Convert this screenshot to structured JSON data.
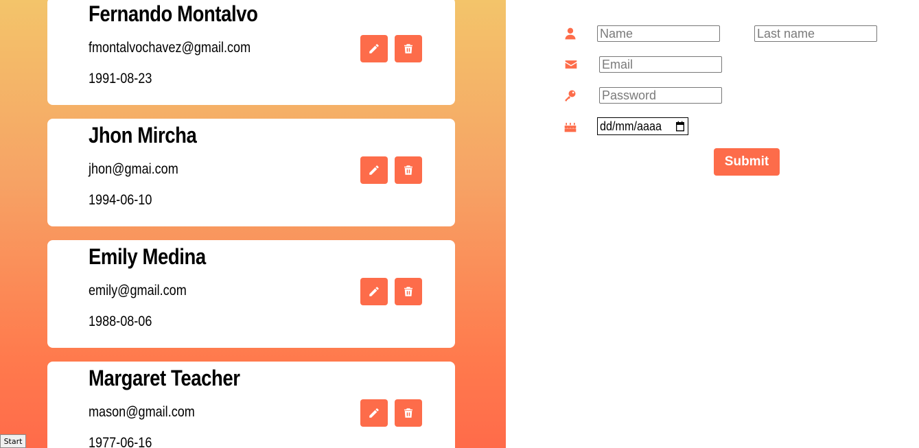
{
  "contacts": [
    {
      "name": "Fernando Montalvo",
      "email": "fmontalvochavez@gmail.com",
      "birthdate": "1991-08-23"
    },
    {
      "name": "Jhon Mircha",
      "email": "jhon@gmai.com",
      "birthdate": "1994-06-10"
    },
    {
      "name": "Emily Medina",
      "email": "emily@gmail.com",
      "birthdate": "1988-08-06"
    },
    {
      "name": "Margaret Teacher",
      "email": "mason@gmail.com",
      "birthdate": "1977-06-16"
    }
  ],
  "icons": {
    "edit": "pencil-icon",
    "delete": "trash-icon",
    "name": "user-icon",
    "email": "envelope-icon",
    "password": "key-icon",
    "birthdate": "cake-icon"
  },
  "form": {
    "name_placeholder": "Name",
    "lastname_placeholder": "Last name",
    "email_placeholder": "Email",
    "password_placeholder": "Password",
    "date_value": "dd/mm/aaaa",
    "submit_label": "Submit"
  },
  "taskbar": {
    "start_label": "Start"
  },
  "colors": {
    "accent": "#fd6c4a",
    "gradient_top": "#f3c46a",
    "gradient_bottom": "#ff6b4a"
  }
}
